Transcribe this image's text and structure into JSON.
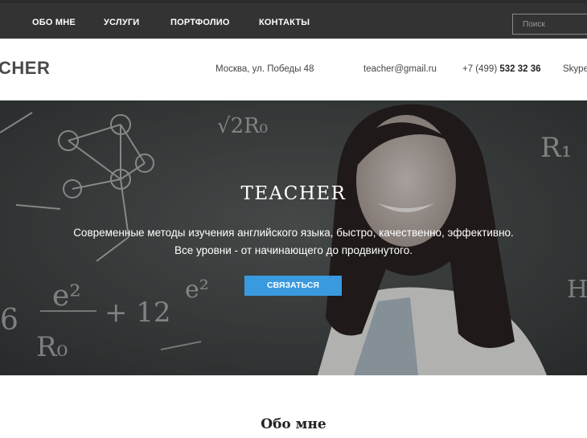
{
  "nav": {
    "items": [
      {
        "label": "ОБО МНЕ"
      },
      {
        "label": "УСЛУГИ"
      },
      {
        "label": "ПОРТФОЛИО"
      },
      {
        "label": "КОНТАКТЫ"
      }
    ],
    "search_placeholder": "Поиск"
  },
  "header": {
    "logo": "CHER",
    "address": "Москва, ул. Победы 48",
    "email": "teacher@gmail.ru",
    "phone_prefix": "+7 (499)",
    "phone_number": "532 32 36",
    "skype": "Skype"
  },
  "hero": {
    "title": "TEACHER",
    "line1": "Современные методы изучения английского языка, быстро, качественно, эффективно.",
    "line2": "Все уровни - от начинающего до продвинутого.",
    "button": "СВЯЗАТЬСЯ",
    "chalk": [
      "√2R₀",
      "R₁",
      "e²",
      "+ 12",
      "R₀",
      "e²",
      "H",
      "6"
    ]
  },
  "about": {
    "title": "Обо мне"
  },
  "colors": {
    "nav_bg": "#333333",
    "accent": "#3a9ae0"
  }
}
